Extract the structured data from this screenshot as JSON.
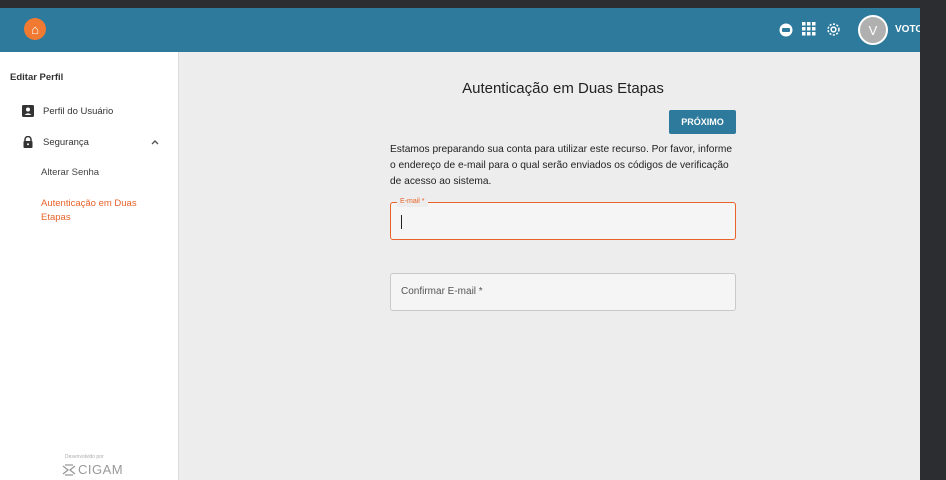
{
  "colors": {
    "primary": "#2e7a9c",
    "accent": "#e8622a",
    "sidebar_bg": "#ffffff",
    "content_bg": "#ededed"
  },
  "topbar": {
    "logo_icon": "home-logo-icon",
    "icons": [
      "chat-icon",
      "apps-grid-icon",
      "settings-gear-icon"
    ],
    "avatar_initial": "V",
    "username": "VOTO"
  },
  "sidebar": {
    "title": "Editar Perfil",
    "items": [
      {
        "label": "Perfil do Usuário",
        "icon": "user-profile-icon"
      },
      {
        "label": "Segurança",
        "icon": "lock-icon"
      }
    ],
    "sub_items": [
      {
        "label": "Alterar Senha"
      },
      {
        "label": "Autenticação em Duas Etapas"
      }
    ],
    "footer_credit": "Desenvolvido por",
    "footer_brand": "CIGAM"
  },
  "main": {
    "title": "Autenticação em Duas Etapas",
    "next_button": "PRÓXIMO",
    "description": "Estamos preparando sua conta para utilizar este recurso. Por favor, informe o endereço de e-mail para o qual serão enviados os códigos de verificação de acesso ao sistema.",
    "email_label": "E-mail *",
    "email_value": "",
    "confirm_label": "Confirmar E-mail *"
  }
}
